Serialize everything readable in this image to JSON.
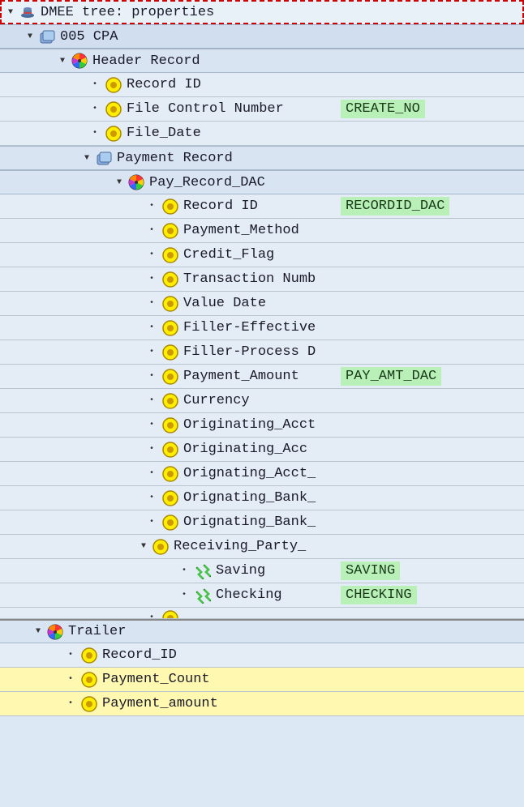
{
  "root": {
    "label": "DMEE tree: properties"
  },
  "cpa": {
    "label": "005 CPA"
  },
  "header_record": {
    "label": "Header Record"
  },
  "record_id": {
    "label": "Record ID"
  },
  "file_control_number": {
    "label": "File Control Number",
    "badge": "CREATE_NO"
  },
  "file_date": {
    "label": "File_Date"
  },
  "payment_record": {
    "label": "Payment Record"
  },
  "pay_record_dac": {
    "label": "Pay_Record_DAC"
  },
  "dac_record_id": {
    "label": "Record ID",
    "badge": "RECORDID_DAC"
  },
  "payment_method": {
    "label": "Payment_Method"
  },
  "credit_flag": {
    "label": "Credit_Flag"
  },
  "transaction_number": {
    "label": "Transaction Numb"
  },
  "value_date": {
    "label": "Value Date"
  },
  "filler_effective": {
    "label": "Filler-Effective"
  },
  "filler_process": {
    "label": "Filler-Process D"
  },
  "payment_amount": {
    "label": "Payment_Amount",
    "badge": "PAY_AMT_DAC"
  },
  "currency": {
    "label": "Currency"
  },
  "originating_acct1": {
    "label": "Originating_Acct"
  },
  "originating_acc": {
    "label": "Originating_Acc"
  },
  "orignating_acct": {
    "label": "Orignating_Acct_"
  },
  "orignating_bank1": {
    "label": "Orignating_Bank_"
  },
  "orignating_bank2": {
    "label": "Orignating_Bank_"
  },
  "receiving_party": {
    "label": "Receiving_Party_"
  },
  "saving": {
    "label": "Saving",
    "badge": "SAVING"
  },
  "checking": {
    "label": "Checking",
    "badge": "CHECKING"
  },
  "trailer": {
    "label": "Trailer"
  },
  "trailer_record_id": {
    "label": "Record_ID"
  },
  "payment_count": {
    "label": "Payment_Count"
  },
  "trailer_payment_amount": {
    "label": "Payment_amount"
  }
}
